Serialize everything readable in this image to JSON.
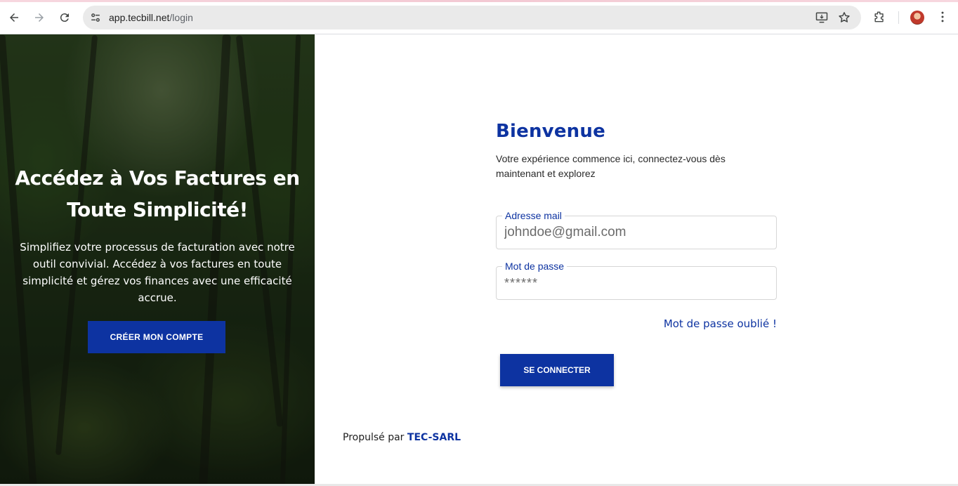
{
  "browser": {
    "url_host": "app.tecbill.net",
    "url_path": "/login",
    "icons": [
      "back-arrow-icon",
      "forward-arrow-icon",
      "reload-icon",
      "site-settings-icon",
      "install-app-icon",
      "bookmark-star-icon",
      "extensions-icon",
      "profile-avatar",
      "more-vert-icon"
    ]
  },
  "hero": {
    "title": "Accédez à Vos Factures en Toute Simplicité!",
    "text": "Simplifiez votre processus de facturation avec notre outil convivial. Accédez à vos factures en toute simplicité et gérez vos finances avec une efficacité accrue.",
    "cta_label": "CRÉER MON COMPTE"
  },
  "form": {
    "title": "Bienvenue",
    "subtitle": "Votre expérience commence ici, connectez-vous dès maintenant et explorez",
    "email_label": "Adresse mail",
    "email_placeholder": "johndoe@gmail.com",
    "password_label": "Mot de passe",
    "password_placeholder": "******",
    "forgot_label": "Mot de passe oublié !",
    "submit_label": "SE CONNECTER"
  },
  "footer": {
    "prefix": "Propulsé par",
    "brand": "TEC-SARL"
  },
  "colors": {
    "brand_blue": "#0d33a1",
    "form_border": "#d6d6d6"
  }
}
